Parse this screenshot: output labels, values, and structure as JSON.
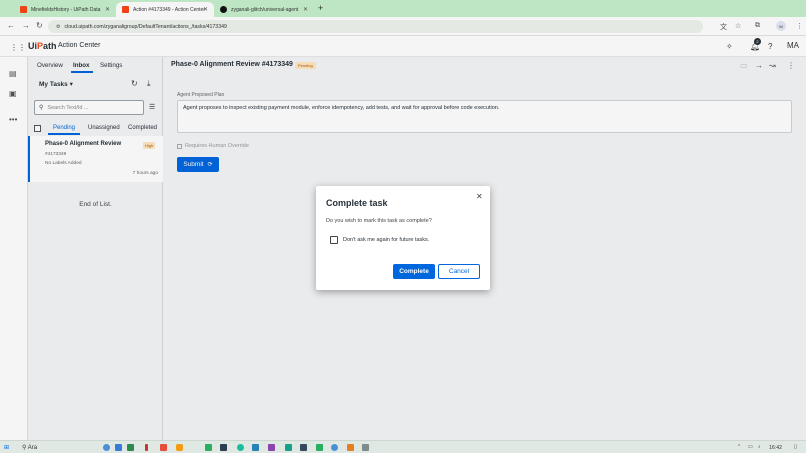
{
  "browser": {
    "tabs": [
      {
        "label": "MinefieldsHistory - UiPath Data",
        "color": "#fa4616"
      },
      {
        "label": "Action #4173349 - Action Center",
        "color": "#fa4616"
      },
      {
        "label": "zyganali-glitch/universal-agent",
        "color": "#111111"
      }
    ],
    "url": "cloud.uipath.com/zyganaligroup/DefaultTenant/actions_/tasks/4173349",
    "profile_initial": "M"
  },
  "header": {
    "brand_logo": "UiPath",
    "app_title": "Action Center",
    "notif_count": "2",
    "user_initials": "MA"
  },
  "left_panel": {
    "tabs": [
      "Overview",
      "Inbox",
      "Settings"
    ],
    "active_tab": "Inbox",
    "list_title": "My Tasks",
    "search_placeholder": "Search Text/Id ...",
    "subtabs": [
      "Pending",
      "Unassigned",
      "Completed"
    ],
    "active_subtab": "Pending",
    "tasks": [
      {
        "title": "Phase-0 Alignment Review",
        "priority": "High",
        "id": "#4173349",
        "labels": "No Labels Added",
        "time": "7 hours ago"
      }
    ],
    "end_of_list": "End of List."
  },
  "main": {
    "title": "Phase-0 Alignment Review #4173349",
    "status": "Pending",
    "plan_label": "Agent Proposed Plan",
    "plan_text": "Agent proposes to inspect existing payment module, enforce idempotency, add tests, and wait for approval before code execution.",
    "override_label": "Requires Human Override",
    "submit_label": "Submit"
  },
  "dialog": {
    "title": "Complete task",
    "body": "Do you wish to mark this task as complete?",
    "checkbox_label": "Don't ask me again for future tasks.",
    "complete_label": "Complete",
    "cancel_label": "Cancel"
  },
  "taskbar": {
    "search_label": "Ara",
    "time": "16:42"
  },
  "colors": {
    "accent": "#0067df",
    "brand": "#fa4616",
    "pending_badge_bg": "#fde7c2"
  }
}
